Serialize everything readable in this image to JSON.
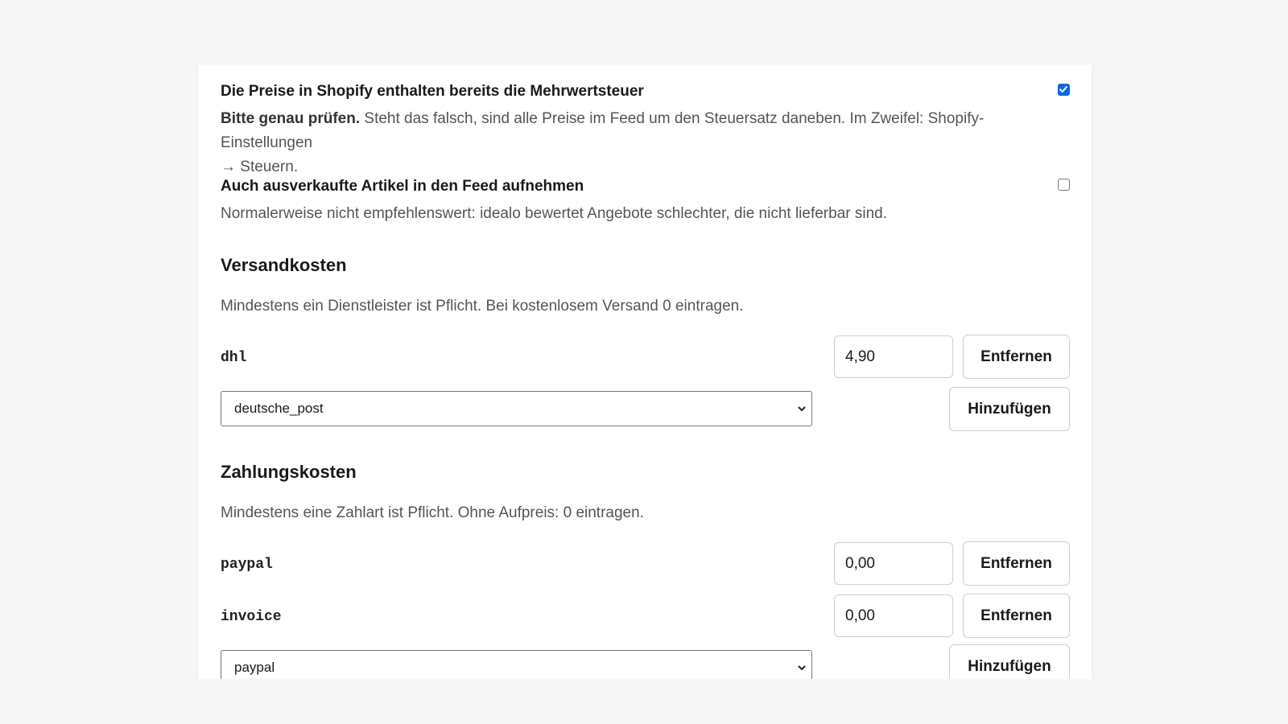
{
  "options": {
    "tax": {
      "title": "Die Preise in Shopify enthalten bereits die Mehrwertsteuer",
      "checked": true,
      "desc_strong": "Bitte genau prüfen.",
      "desc_line1": " Steht das falsch, sind alle Preise im Feed um den Steuersatz daneben. Im Zweifel: Shopify-Einstellungen",
      "desc_line2": "→ Steuern."
    },
    "soldout": {
      "title": "Auch ausverkaufte Artikel in den Feed aufnehmen",
      "checked": false,
      "desc": "Normalerweise nicht empfehlenswert: idealo bewertet Angebote schlechter, die nicht lieferbar sind."
    }
  },
  "shipping": {
    "heading": "Versandkosten",
    "desc": "Mindestens ein Dienstleister ist Pflicht. Bei kostenlosem Versand 0 eintragen.",
    "rows": [
      {
        "code": "dhl",
        "amount": "4,90",
        "remove_label": "Entfernen"
      }
    ],
    "select_value": "deutsche_post",
    "add_label": "Hinzufügen"
  },
  "payment": {
    "heading": "Zahlungskosten",
    "desc": "Mindestens eine Zahlart ist Pflicht. Ohne Aufpreis: 0 eintragen.",
    "rows": [
      {
        "code": "paypal",
        "amount": "0,00",
        "remove_label": "Entfernen"
      },
      {
        "code": "invoice",
        "amount": "0,00",
        "remove_label": "Entfernen"
      }
    ],
    "select_value": "paypal",
    "add_label": "Hinzufügen"
  },
  "colors": {
    "accent": "#0b66e4",
    "background": "#f6f6f6",
    "card": "#ffffff"
  }
}
